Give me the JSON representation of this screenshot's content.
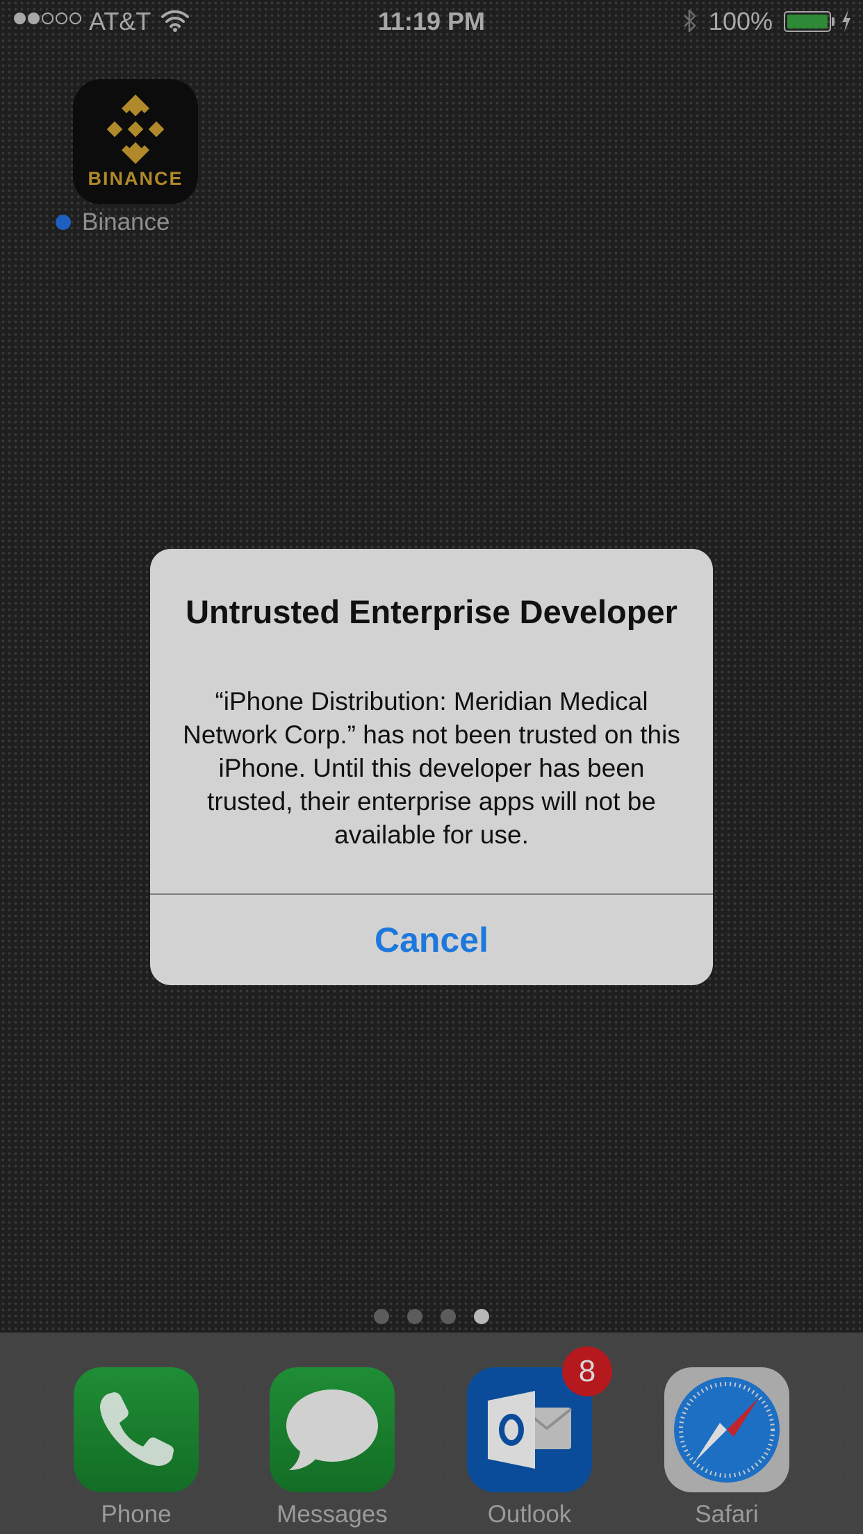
{
  "status_bar": {
    "signal_bars_filled": 2,
    "signal_bars_total": 5,
    "carrier": "AT&T",
    "time": "11:19 PM",
    "battery_percent": "100%",
    "battery_level": 1.0,
    "charging": true,
    "bluetooth": true
  },
  "home_apps": [
    {
      "name": "Binance",
      "icon_text": "BINANCE",
      "newly_installed": true,
      "icon": "binance-logo-icon"
    }
  ],
  "alert": {
    "title": "Untrusted Enterprise Developer",
    "message": "“iPhone Distribution: Meridian Medical Network Corp.” has not been trusted on this iPhone. Until this developer has been trusted, their enterprise apps will not be available for use.",
    "cancel_label": "Cancel"
  },
  "page_indicator": {
    "total": 4,
    "active_index": 3
  },
  "dock": {
    "apps": [
      {
        "label": "Phone",
        "icon": "phone-handset-icon"
      },
      {
        "label": "Messages",
        "icon": "speech-bubble-icon"
      },
      {
        "label": "Outlook",
        "icon": "outlook-icon",
        "badge": "8"
      },
      {
        "label": "Safari",
        "icon": "compass-icon"
      }
    ]
  },
  "colors": {
    "binance_gold": "#b08a2a",
    "alert_button_blue": "#1d78dc",
    "badge_red": "#b5191e",
    "battery_green": "#2e8a36"
  }
}
